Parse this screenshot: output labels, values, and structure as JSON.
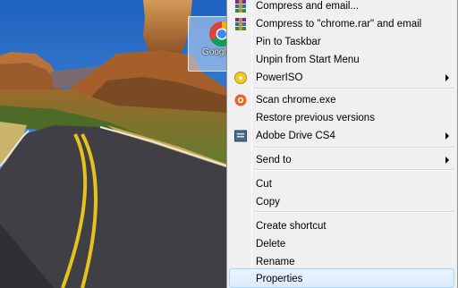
{
  "desktop": {
    "shortcut_label": "Google Chrome"
  },
  "context_menu": {
    "items": [
      {
        "label": "Compress and email...",
        "icon": "winrar-archive-icon",
        "submenu": false
      },
      {
        "label": "Compress to \"chrome.rar\" and email",
        "icon": "winrar-archive-icon",
        "submenu": false
      },
      {
        "label": "Pin to Taskbar",
        "icon": "",
        "submenu": false
      },
      {
        "label": "Unpin from Start Menu",
        "icon": "",
        "submenu": false
      },
      {
        "label": "PowerISO",
        "icon": "poweriso-icon",
        "submenu": true
      },
      {
        "label": "Scan chrome.exe",
        "icon": "antivirus-scan-icon",
        "submenu": false
      },
      {
        "label": "Restore previous versions",
        "icon": "",
        "submenu": false
      },
      {
        "label": "Adobe Drive CS4",
        "icon": "adobe-drive-icon",
        "submenu": true
      },
      {
        "label": "Send to",
        "icon": "",
        "submenu": true
      },
      {
        "label": "Cut",
        "icon": "",
        "submenu": false
      },
      {
        "label": "Copy",
        "icon": "",
        "submenu": false
      },
      {
        "label": "Create shortcut",
        "icon": "",
        "submenu": false
      },
      {
        "label": "Delete",
        "icon": "",
        "submenu": false
      },
      {
        "label": "Rename",
        "icon": "",
        "submenu": false
      },
      {
        "label": "Properties",
        "icon": "",
        "submenu": false,
        "highlighted": true
      }
    ]
  },
  "colors": {
    "menu_background": "#f0f0f0",
    "highlight_border": "#a8d8fb",
    "sky": "#2a6fc4",
    "road": "#3f3f45",
    "road_line": "#e6c21a"
  }
}
